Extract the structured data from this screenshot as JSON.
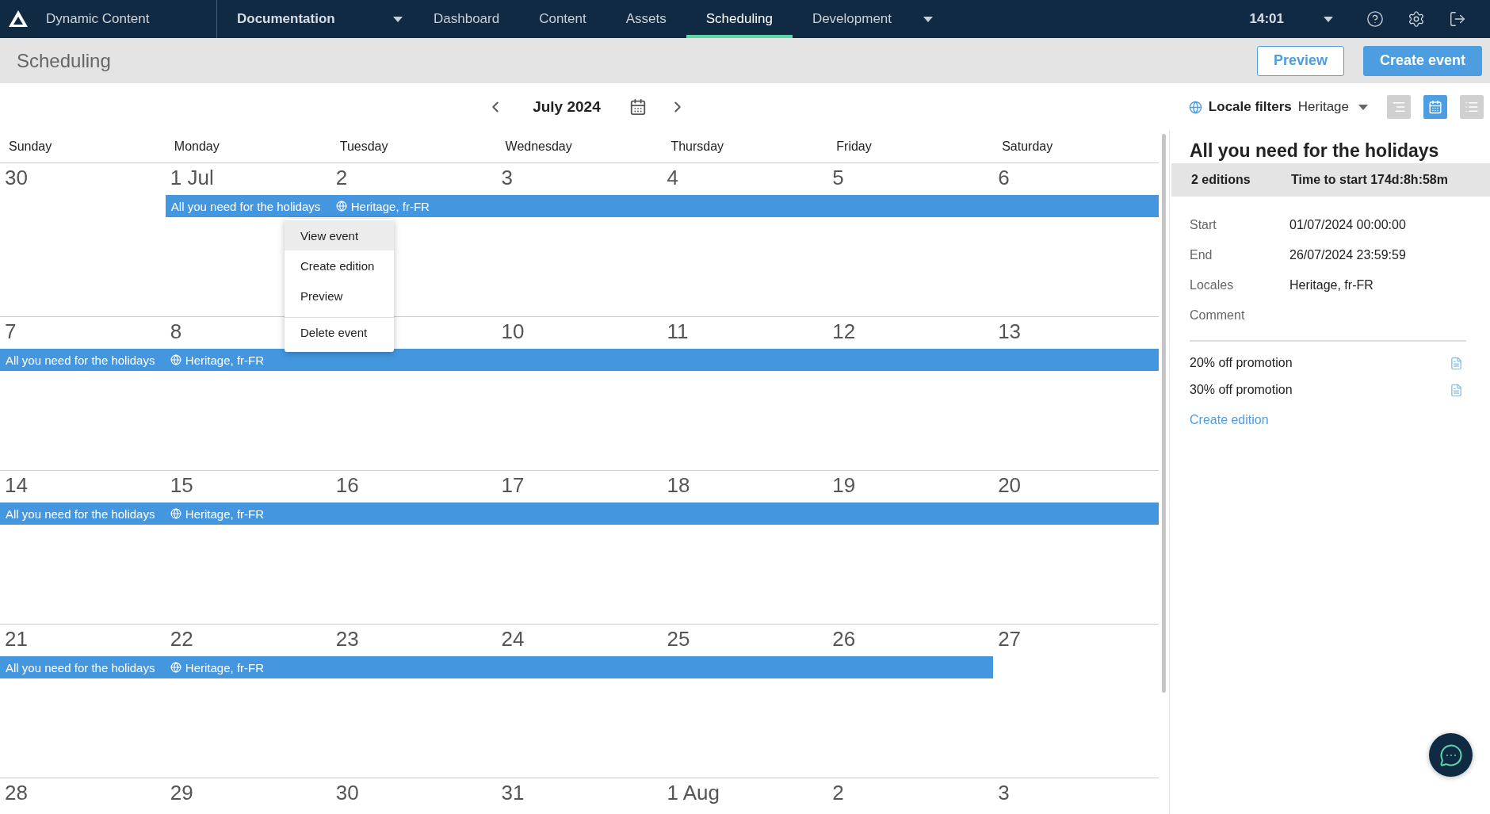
{
  "app": {
    "name": "Dynamic Content"
  },
  "nav": {
    "hub": "Documentation",
    "items": [
      {
        "label": "Dashboard",
        "selected": false,
        "dropdown": false
      },
      {
        "label": "Content",
        "selected": false,
        "dropdown": false
      },
      {
        "label": "Assets",
        "selected": false,
        "dropdown": false
      },
      {
        "label": "Scheduling",
        "selected": true,
        "dropdown": false
      },
      {
        "label": "Development",
        "selected": false,
        "dropdown": true
      }
    ]
  },
  "clock": "14:01",
  "page_title": "Scheduling",
  "actions": [
    {
      "label": "Preview",
      "kind": "secondary"
    },
    {
      "label": "Create event",
      "kind": "primary"
    }
  ],
  "calendar": {
    "month": "July 2024",
    "weekdays": [
      "Sunday",
      "Monday",
      "Tuesday",
      "Wednesday",
      "Thursday",
      "Friday",
      "Saturday"
    ],
    "weeks": [
      {
        "days": [
          {
            "date": "30",
            "in_event": false
          },
          {
            "date": "1 Jul",
            "in_event": true
          },
          {
            "date": "2",
            "in_event": true
          },
          {
            "date": "3",
            "in_event": true
          },
          {
            "date": "4",
            "in_event": true
          },
          {
            "date": "5",
            "in_event": true
          },
          {
            "date": "6",
            "in_event": true
          }
        ],
        "event": {
          "title": "All you need for the holidays",
          "locales": "Heritage, fr-FR"
        }
      },
      {
        "days": [
          {
            "date": "7",
            "in_event": true
          },
          {
            "date": "8",
            "in_event": true
          },
          {
            "in_event": true
          },
          {
            "date": "10",
            "in_event": true
          },
          {
            "date": "11",
            "in_event": true
          },
          {
            "date": "12",
            "in_event": true
          },
          {
            "date": "13",
            "in_event": true
          }
        ],
        "event": {
          "title": "All you need for the holidays",
          "locales": "Heritage, fr-FR"
        }
      },
      {
        "days": [
          {
            "date": "14",
            "in_event": true
          },
          {
            "date": "15",
            "in_event": true
          },
          {
            "date": "16",
            "in_event": true
          },
          {
            "date": "17",
            "in_event": true
          },
          {
            "date": "18",
            "in_event": true
          },
          {
            "date": "19",
            "in_event": true
          },
          {
            "date": "20",
            "in_event": true
          }
        ],
        "event": {
          "title": "All you need for the holidays",
          "locales": "Heritage, fr-FR"
        }
      },
      {
        "days": [
          {
            "date": "21",
            "in_event": true
          },
          {
            "date": "22",
            "in_event": true
          },
          {
            "date": "23",
            "in_event": true
          },
          {
            "date": "24",
            "in_event": true
          },
          {
            "date": "25",
            "in_event": true
          },
          {
            "date": "26",
            "in_event": true
          },
          {
            "date": "27",
            "in_event": false
          }
        ],
        "event": {
          "title": "All you need for the holidays",
          "locales": "Heritage, fr-FR"
        }
      },
      {
        "days": [
          {
            "date": "28"
          },
          {
            "date": "29"
          },
          {
            "date": "30"
          },
          {
            "date": "31"
          },
          {
            "date": "1 Aug"
          },
          {
            "date": "2"
          },
          {
            "date": "3"
          }
        ]
      }
    ]
  },
  "locale_filter": {
    "label": "Locale filters",
    "value": "Heritage"
  },
  "views": [
    {
      "kind": "timeline",
      "selected": false
    },
    {
      "kind": "calendar",
      "selected": true
    },
    {
      "kind": "list",
      "selected": false
    }
  ],
  "context_menu": {
    "items": [
      {
        "label": "View event",
        "highlighted": true,
        "separated": false
      },
      {
        "label": "Create edition",
        "highlighted": false,
        "separated": false
      },
      {
        "label": "Preview",
        "highlighted": false,
        "separated": false
      },
      {
        "label": "Delete event",
        "highlighted": false,
        "separated": true
      }
    ]
  },
  "details": {
    "title": "All you need for the holidays",
    "editions_count": "2 editions",
    "time_to_start": "Time to start 174d:8h:58m",
    "fields": [
      {
        "label": "Start",
        "value": "01/07/2024 00:00:00"
      },
      {
        "label": "End",
        "value": "26/07/2024 23:59:59"
      },
      {
        "label": "Locales",
        "value": "Heritage, fr-FR"
      },
      {
        "label": "Comment"
      }
    ],
    "editions": [
      "20% off promotion",
      "30% off promotion"
    ],
    "create_link": "Create edition"
  }
}
